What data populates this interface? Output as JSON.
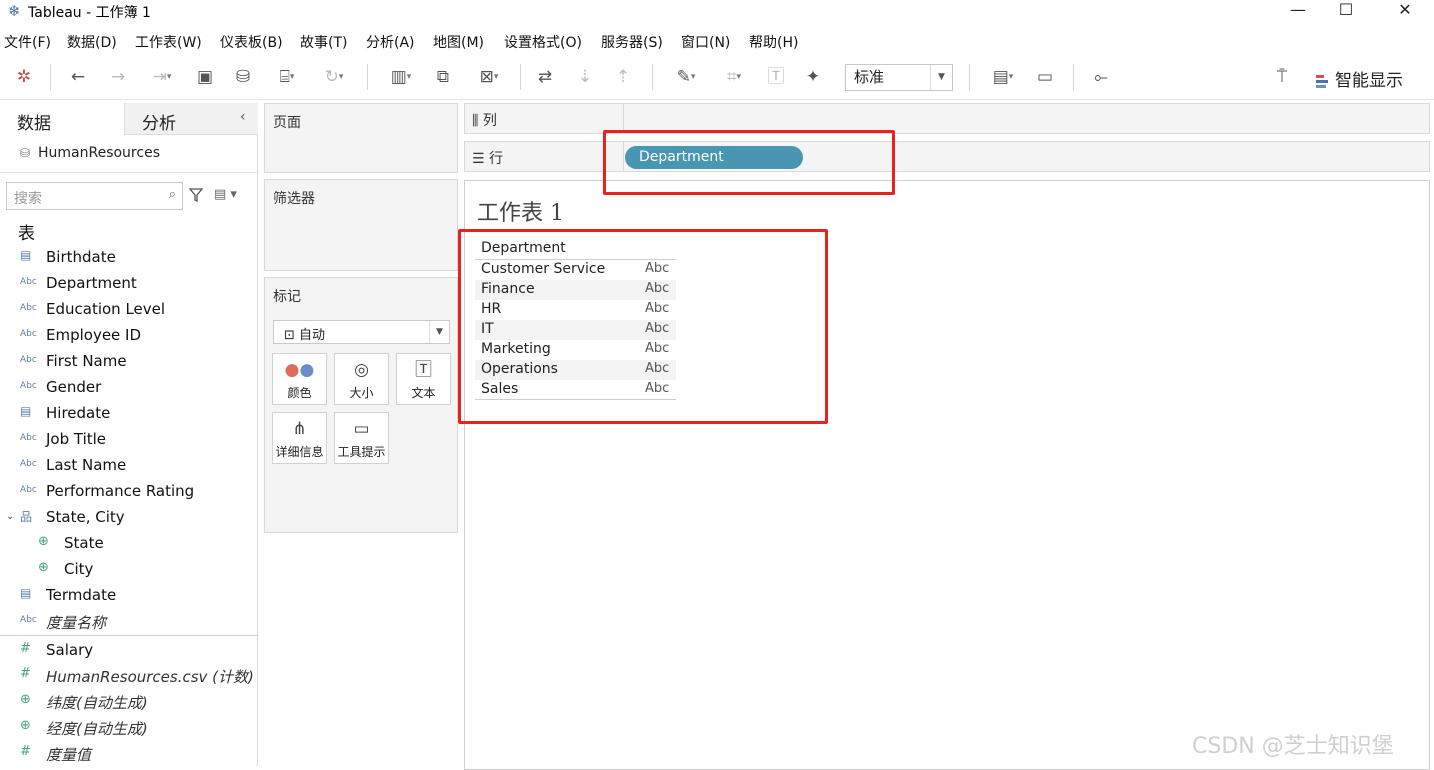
{
  "window": {
    "title": "Tableau - 工作簿 1",
    "controls": {
      "minimize": "—",
      "maximize": "☐",
      "close": "✕"
    }
  },
  "menu": [
    "文件(F)",
    "数据(D)",
    "工作表(W)",
    "仪表板(B)",
    "故事(T)",
    "分析(A)",
    "地图(M)",
    "设置格式(O)",
    "服务器(S)",
    "窗口(N)",
    "帮助(H)"
  ],
  "toolbar": {
    "fit_value": "标准",
    "show_me_label": "智能显示",
    "icons": [
      "tableau-logo-icon",
      "undo-icon",
      "redo-icon",
      "replay-icon",
      "save-icon",
      "new-datasource-icon",
      "pause-update-icon",
      "refresh-icon",
      "new-sheet-icon",
      "duplicate-sheet-icon",
      "clear-sheet-icon",
      "swap-icon",
      "sort-ascending-icon",
      "sort-descending-icon",
      "highlight-icon",
      "group-icon",
      "label-icon",
      "pin-icon",
      "show-cards-icon",
      "presentation-icon",
      "share-icon",
      "tooltip-icon"
    ],
    "colors": {
      "showme_bar1": "#d9534f",
      "showme_bar2": "#4a72b0",
      "showme_bar3": "#6e8fc9"
    }
  },
  "data_pane": {
    "tabs": {
      "data": "数据",
      "analysis": "分析"
    },
    "collapse": "‹",
    "datasource": "HumanResources",
    "search_placeholder": "搜索",
    "tables_heading": "表",
    "fields": [
      {
        "name": "Birthdate",
        "type": "date"
      },
      {
        "name": "Department",
        "type": "string"
      },
      {
        "name": "Education Level",
        "type": "string"
      },
      {
        "name": "Employee ID",
        "type": "string"
      },
      {
        "name": "First Name",
        "type": "string"
      },
      {
        "name": "Gender",
        "type": "string"
      },
      {
        "name": "Hiredate",
        "type": "date"
      },
      {
        "name": "Job Title",
        "type": "string"
      },
      {
        "name": "Last Name",
        "type": "string"
      },
      {
        "name": "Performance Rating",
        "type": "string"
      },
      {
        "name": "State, City",
        "type": "hierarchy"
      },
      {
        "name": "State",
        "type": "geo"
      },
      {
        "name": "City",
        "type": "geo"
      },
      {
        "name": "Termdate",
        "type": "date"
      },
      {
        "name": "度量名称",
        "type": "string"
      }
    ],
    "measures": [
      {
        "name": "Salary",
        "type": "number"
      },
      {
        "name": "HumanResources.csv (计数)",
        "type": "number"
      },
      {
        "name": "纬度(自动生成)",
        "type": "geo"
      },
      {
        "name": "经度(自动生成)",
        "type": "geo"
      },
      {
        "name": "度量值",
        "type": "number"
      }
    ],
    "type_glyphs": {
      "string": "Abc",
      "date": "▤",
      "geo": "⊕",
      "number": "#",
      "hierarchy": "品"
    }
  },
  "cards": {
    "pages": "页面",
    "filters": "筛选器",
    "marks": "标记",
    "marks_type": "自动",
    "mark_buttons": [
      "颜色",
      "大小",
      "文本",
      "详细信息",
      "工具提示"
    ]
  },
  "shelves": {
    "columns_label": "列",
    "rows_label": "行",
    "row_pill": "Department"
  },
  "view": {
    "sheet_title": "工作表 1",
    "table_header": "Department",
    "rows": [
      {
        "label": "Customer Service",
        "value": "Abc"
      },
      {
        "label": "Finance",
        "value": "Abc"
      },
      {
        "label": "HR",
        "value": "Abc"
      },
      {
        "label": "IT",
        "value": "Abc"
      },
      {
        "label": "Marketing",
        "value": "Abc"
      },
      {
        "label": "Operations",
        "value": "Abc"
      },
      {
        "label": "Sales",
        "value": "Abc"
      }
    ]
  },
  "watermark": "CSDN @芝士知识堡",
  "accent_colors": {
    "pill": "#4996b2",
    "annotation": "#e8231f"
  }
}
